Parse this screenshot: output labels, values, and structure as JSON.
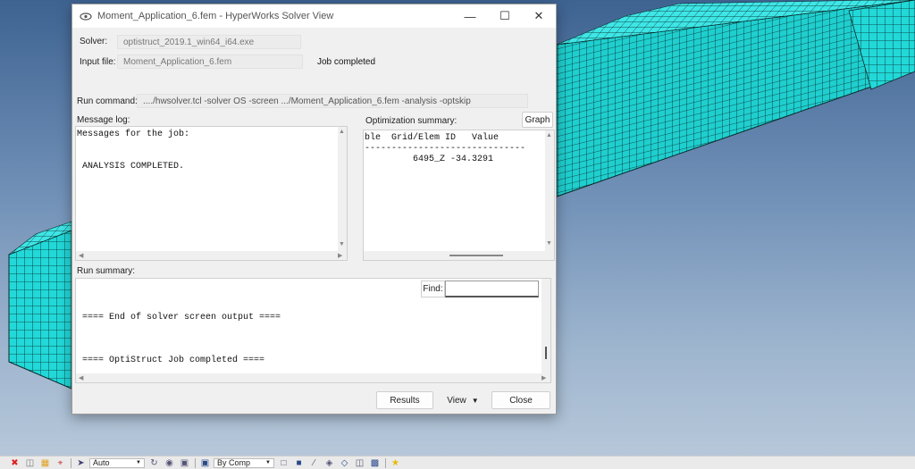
{
  "dialog": {
    "title": "Moment_Application_6.fem - HyperWorks Solver View",
    "solver_label": "Solver:",
    "solver_value": "optistruct_2019.1_win64_i64.exe",
    "input_label": "Input file:",
    "input_value": "Moment_Application_6.fem",
    "job_status": "Job completed",
    "run_command_label": "Run command:",
    "run_command_value": "..../hwsolver.tcl -solver OS -screen .../Moment_Application_6.fem -analysis -optskip",
    "message_log_label": "Message log:",
    "message_log_lines": [
      "Messages for the job:",
      "",
      "",
      " ANALYSIS COMPLETED."
    ],
    "opt_summary_label": "Optimization summary:",
    "graph_button": "Graph",
    "opt_summary_lines": [
      "ble  Grid/Elem ID   Value",
      "------------------------------",
      "         6495_Z -34.3291"
    ],
    "run_summary_label": "Run summary:",
    "find_label": "Find:",
    "find_value": "",
    "run_summary_lines": [
      "",
      "",
      "",
      " ==== End of solver screen output ====",
      "",
      "",
      "",
      " ==== OptiStruct Job completed ===="
    ],
    "results_button": "Results",
    "view_button": "View",
    "close_button": "Close"
  },
  "toolbar": {
    "auto_select": "Auto",
    "bycomp_select": "By Comp"
  },
  "colors": {
    "mesh_fill": "#22d8d8",
    "mesh_line": "#0a2a2a",
    "background_top": "#3e6391"
  }
}
